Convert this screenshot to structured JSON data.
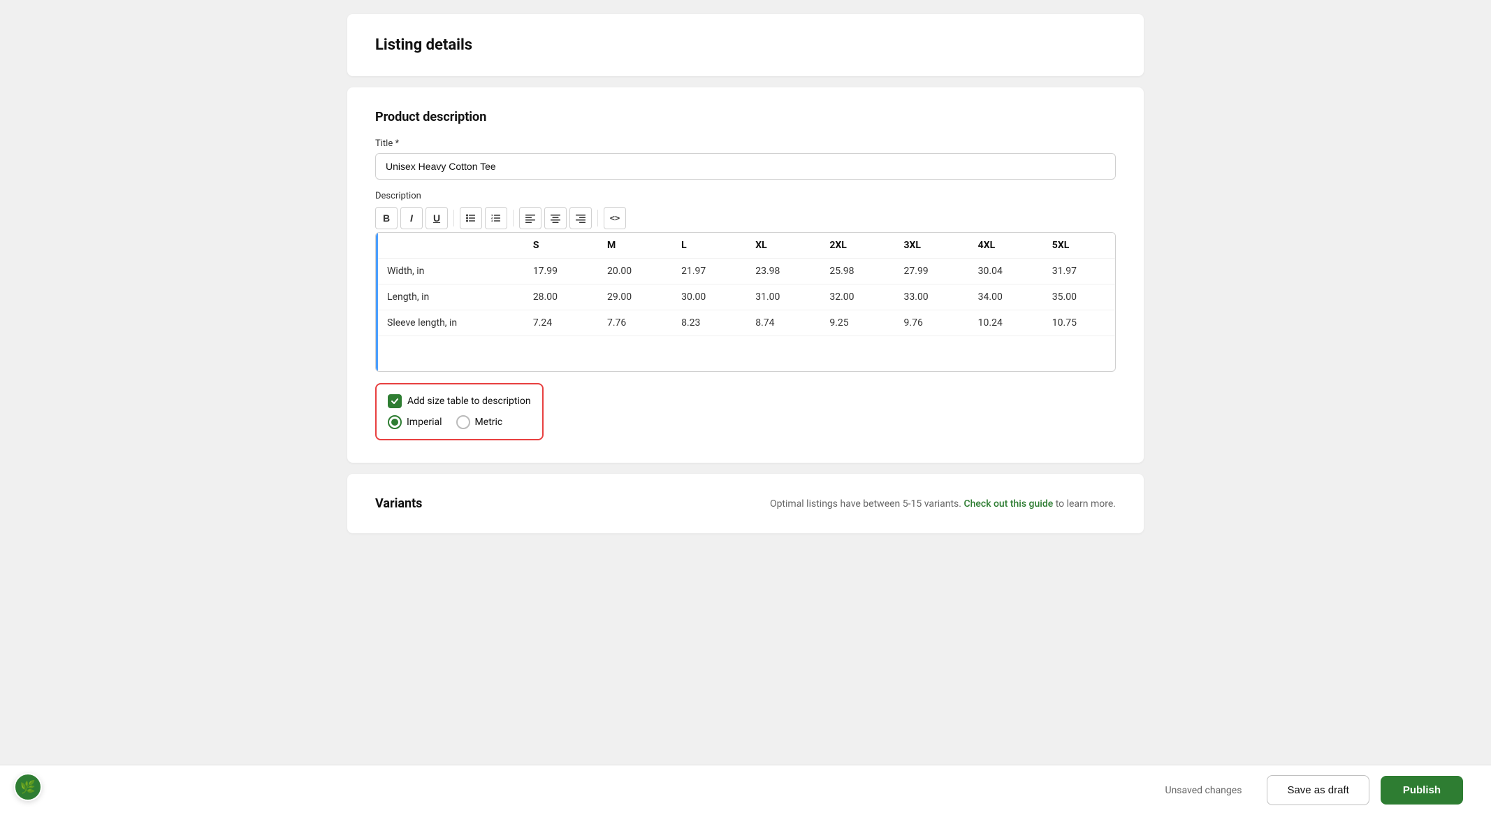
{
  "page": {
    "title": "Listing details"
  },
  "product_description": {
    "section_title": "Product description",
    "title_label": "Title *",
    "title_value": "Unisex Heavy Cotton Tee",
    "description_label": "Description",
    "toolbar": {
      "bold": "B",
      "italic": "I",
      "underline": "U",
      "unordered_list": "ul",
      "ordered_list": "ol",
      "align_left": "al",
      "align_center": "ac",
      "align_right": "ar",
      "code": "<>"
    }
  },
  "size_table": {
    "headers": [
      "",
      "S",
      "M",
      "L",
      "XL",
      "2XL",
      "3XL",
      "4XL",
      "5XL"
    ],
    "rows": [
      {
        "label": "Width, in",
        "values": [
          "17.99",
          "20.00",
          "21.97",
          "23.98",
          "25.98",
          "27.99",
          "30.04",
          "31.97"
        ]
      },
      {
        "label": "Length, in",
        "values": [
          "28.00",
          "29.00",
          "30.00",
          "31.00",
          "32.00",
          "33.00",
          "34.00",
          "35.00"
        ]
      },
      {
        "label": "Sleeve length, in",
        "values": [
          "7.24",
          "7.76",
          "8.23",
          "8.74",
          "9.25",
          "9.76",
          "10.24",
          "10.75"
        ]
      }
    ]
  },
  "add_size_table": {
    "checkbox_label": "Add size table to description",
    "imperial_label": "Imperial",
    "metric_label": "Metric",
    "imperial_checked": true,
    "metric_checked": false
  },
  "variants": {
    "section_title": "Variants",
    "hint_text": "Optimal listings have between 5-15 variants.",
    "link_text": "Check out this guide",
    "hint_suffix": "to learn more."
  },
  "bottom_bar": {
    "unsaved_label": "Unsaved changes",
    "save_draft_label": "Save as draft",
    "publish_label": "Publish"
  },
  "avatar": {
    "icon": "🌿"
  }
}
